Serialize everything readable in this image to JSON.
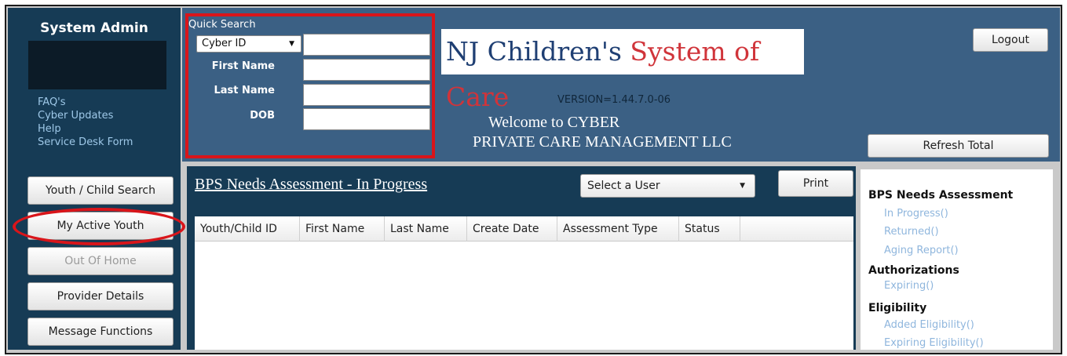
{
  "sidebar": {
    "title": "System Admin",
    "links": [
      "FAQ's",
      "Cyber Updates",
      "Help",
      "Service Desk Form"
    ],
    "nav": [
      "Youth / Child Search",
      "My Active Youth",
      "Out Of Home",
      "Provider Details",
      "Message Functions"
    ]
  },
  "quick_search": {
    "title": "Quick Search",
    "select_value": "Cyber ID",
    "labels": [
      "First Name",
      "Last Name",
      "DOB"
    ]
  },
  "header": {
    "logo_part1": "NJ Children's",
    "logo_part2": "System of Care",
    "version": "VERSION=1.44.7.0-06",
    "welcome": "Welcome to CYBER",
    "company": "PRIVATE CARE MANAGEMENT LLC",
    "logout": "Logout",
    "refresh": "Refresh Total"
  },
  "main": {
    "title": "BPS Needs Assessment - In Progress",
    "user_select": "Select a User",
    "print": "Print",
    "columns": [
      "Youth/Child ID",
      "First Name",
      "Last Name",
      "Create Date",
      "Assessment Type",
      "Status"
    ]
  },
  "right_panel": {
    "section1": "BPS Needs Assessment",
    "section1_links": [
      "In Progress()",
      "Returned()",
      "Aging Report()"
    ],
    "section2": "Authorizations",
    "section2_links": [
      "Expiring()"
    ],
    "section3": "Eligibility",
    "section3_links": [
      "Added Eligibility()",
      "Expiring Eligibility()"
    ]
  },
  "colors": {
    "dark_panel": "#163b55",
    "header_blue": "#3b6084",
    "highlight_red": "#d9151a",
    "link_blue": "#8fb6dd"
  }
}
